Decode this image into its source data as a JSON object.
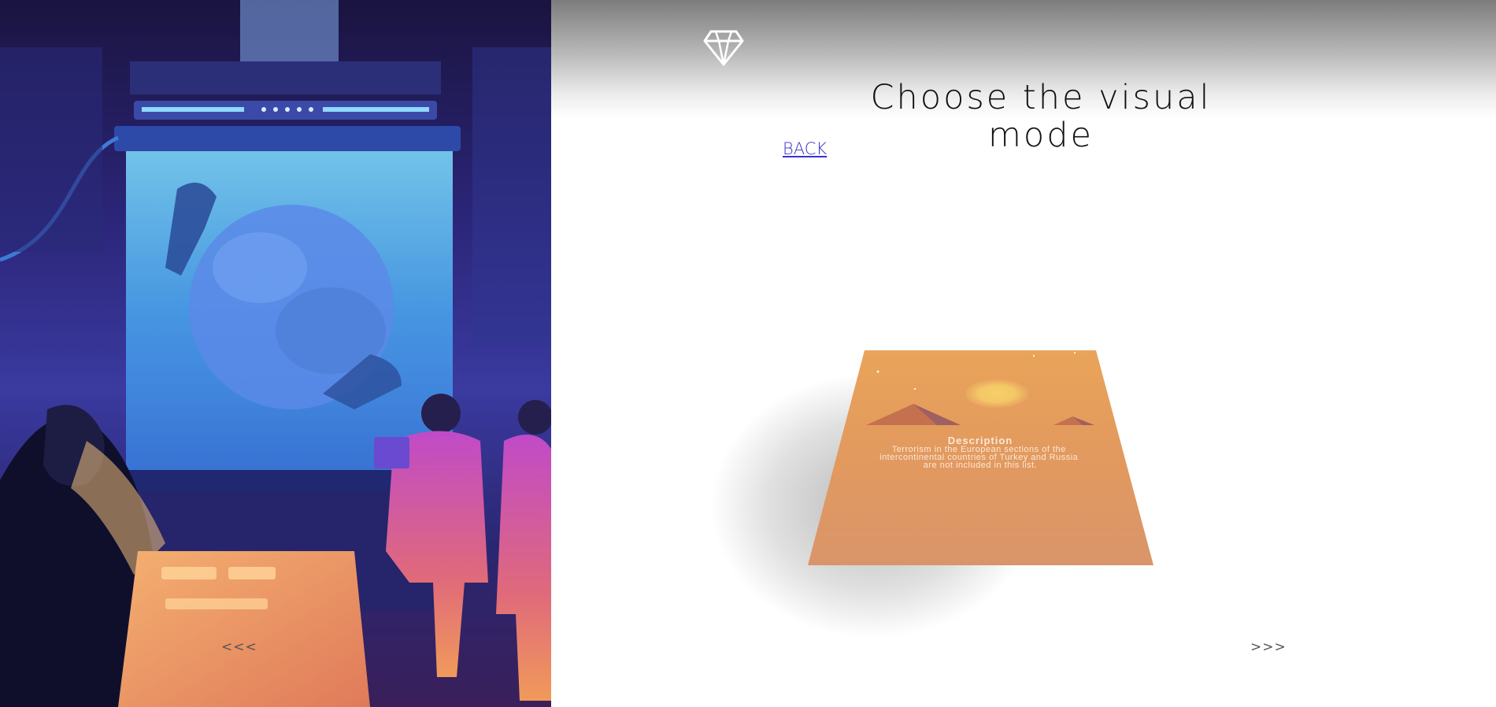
{
  "heading": {
    "title": "Choose the visual mode"
  },
  "navigation": {
    "back_label": "BACK",
    "prev_label": "<<<",
    "next_label": ">>>"
  },
  "card": {
    "heading": "Description",
    "text": "Terrorism in the European sections of the intercontinental countries of Turkey and Russia are not included in this list."
  },
  "icons": {
    "logo": "diamond-icon"
  },
  "colors": {
    "card_top": "#e9a459",
    "card_bottom": "#d9956a",
    "sun": "#f3c765",
    "link": "#3a2fd0",
    "illustration_dark": "#1a1440",
    "illustration_glow": "#6ad0ff"
  }
}
